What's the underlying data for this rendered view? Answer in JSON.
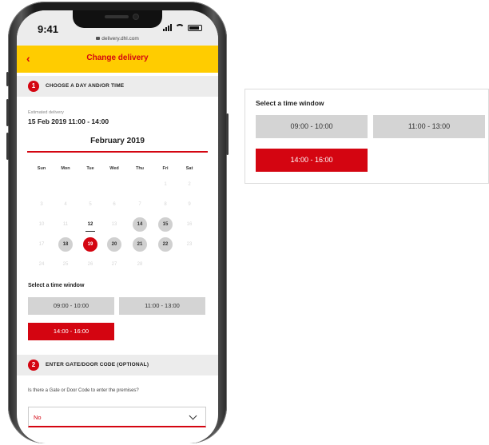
{
  "status": {
    "time": "9:41",
    "url": "delivery.dhl.com"
  },
  "header": {
    "back_glyph": "‹",
    "title": "Change delivery"
  },
  "step1": {
    "number": "1",
    "title": "CHOOSE A DAY AND/OR TIME"
  },
  "estimated": {
    "label": "Estimated delivery",
    "value": "15 Feb 2019 11:00 - 14:00"
  },
  "calendar": {
    "month": "February 2019",
    "weekdays": [
      "Sun",
      "Mon",
      "Tue",
      "Wed",
      "Thu",
      "Fri",
      "Sat"
    ],
    "weeks": [
      [
        null,
        null,
        null,
        null,
        null,
        {
          "d": "1",
          "s": "disabled"
        },
        {
          "d": "2",
          "s": "disabled"
        }
      ],
      [
        {
          "d": "3",
          "s": "disabled"
        },
        {
          "d": "4",
          "s": "disabled"
        },
        {
          "d": "5",
          "s": "disabled"
        },
        {
          "d": "6",
          "s": "disabled"
        },
        {
          "d": "7",
          "s": "disabled"
        },
        {
          "d": "8",
          "s": "disabled"
        },
        {
          "d": "9",
          "s": "disabled"
        }
      ],
      [
        {
          "d": "10",
          "s": "disabled"
        },
        {
          "d": "11",
          "s": "disabled"
        },
        {
          "d": "12",
          "s": "today"
        },
        {
          "d": "13",
          "s": "disabled"
        },
        {
          "d": "14",
          "s": "available"
        },
        {
          "d": "15",
          "s": "available"
        },
        {
          "d": "16",
          "s": "disabled"
        }
      ],
      [
        {
          "d": "17",
          "s": "disabled"
        },
        {
          "d": "18",
          "s": "available"
        },
        {
          "d": "19",
          "s": "selected"
        },
        {
          "d": "20",
          "s": "available"
        },
        {
          "d": "21",
          "s": "available"
        },
        {
          "d": "22",
          "s": "available"
        },
        {
          "d": "23",
          "s": "disabled"
        }
      ],
      [
        {
          "d": "24",
          "s": "disabled"
        },
        {
          "d": "25",
          "s": "disabled"
        },
        {
          "d": "26",
          "s": "disabled"
        },
        {
          "d": "27",
          "s": "disabled"
        },
        {
          "d": "28",
          "s": "disabled"
        },
        null,
        null
      ]
    ]
  },
  "time_window": {
    "label": "Select a time window",
    "slots": [
      {
        "label": "09:00 - 10:00",
        "selected": false
      },
      {
        "label": "11:00 - 13:00",
        "selected": false
      },
      {
        "label": "14:00 - 16:00",
        "selected": true
      }
    ]
  },
  "step2": {
    "number": "2",
    "title": "ENTER GATE/DOOR CODE (OPTIONAL)"
  },
  "gate": {
    "question": "Is there a Gate or Door Code to enter the premises?",
    "selected": "No"
  },
  "zoom_panel": {
    "label": "Select a time window",
    "slots": [
      {
        "label": "09:00 - 10:00",
        "selected": false
      },
      {
        "label": "11:00 - 13:00",
        "selected": false
      },
      {
        "label": "14:00 - 16:00",
        "selected": true
      }
    ]
  },
  "colors": {
    "brand_yellow": "#ffcc00",
    "brand_red": "#d40511",
    "slot_grey": "#d4d4d4",
    "available_grey": "#d0d0d0"
  }
}
